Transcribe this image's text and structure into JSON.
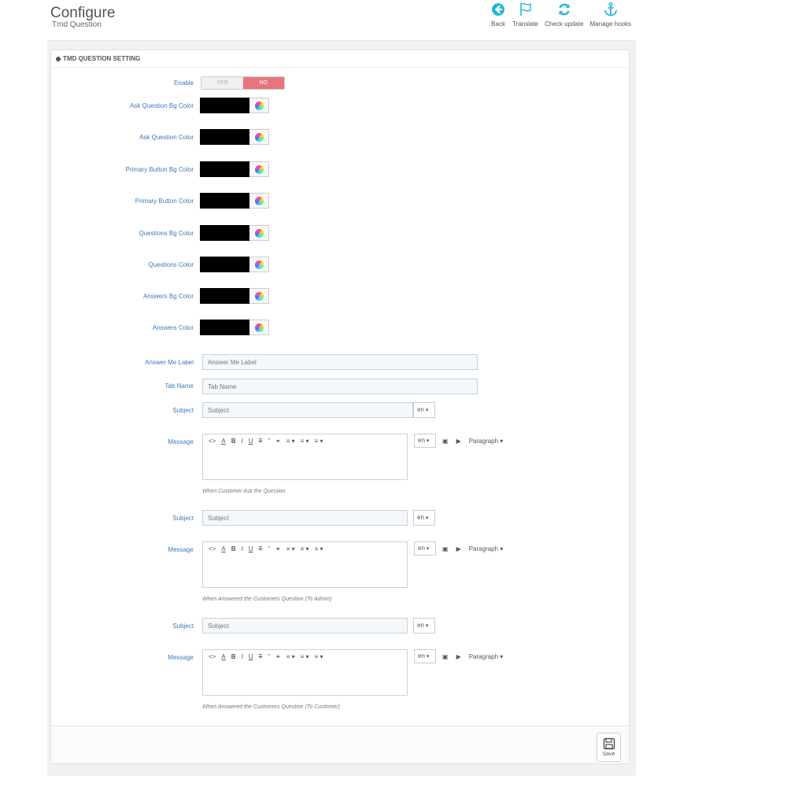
{
  "header": {
    "title": "Configure",
    "subtitle": "Tmd Question",
    "toolbar": [
      {
        "label": "Back",
        "icon": "back-arrow-icon"
      },
      {
        "label": "Translate",
        "icon": "flag-icon"
      },
      {
        "label": "Check update",
        "icon": "refresh-icon"
      },
      {
        "label": "Manage hooks",
        "icon": "anchor-icon"
      }
    ]
  },
  "panel": {
    "title": "TMD QUESTION SETTING",
    "enable": {
      "label": "Enable",
      "yes": "YES",
      "no": "NO",
      "selected": "NO"
    },
    "colors": [
      {
        "label": "Ask Question Bg Color",
        "value": "#000000"
      },
      {
        "label": "Ask Question Color",
        "value": "#000000"
      },
      {
        "label": "Primary Button Bg Color",
        "value": "#000000"
      },
      {
        "label": "Primary Button Color",
        "value": "#000000"
      },
      {
        "label": "Questions Bg Color",
        "value": "#000000"
      },
      {
        "label": "Questions Color",
        "value": "#000000"
      },
      {
        "label": "Answers Bg Color",
        "value": "#000000"
      },
      {
        "label": "Answers Color",
        "value": "#000000"
      }
    ],
    "answer_me_label": {
      "label": "Answer Me Label",
      "placeholder": "Answer Me Label"
    },
    "tab_name": {
      "label": "Tab Name",
      "placeholder": "Tab Name"
    },
    "emails": [
      {
        "subject_label": "Subject",
        "subject_placeholder": "Subject",
        "lang": "en",
        "message_label": "Message",
        "help": "When Customer Ask the Question"
      },
      {
        "subject_label": "Subject",
        "subject_placeholder": "Subject",
        "lang": "en",
        "message_label": "Message",
        "help": "When Answered the Customers Question (To Admin)"
      },
      {
        "subject_label": "Subject",
        "subject_placeholder": "Subject",
        "lang": "en",
        "message_label": "Message",
        "help": "When Answered the Customers Question (To Customer)"
      }
    ],
    "editor": {
      "paragraph": "Paragraph",
      "lang": "en"
    },
    "save_label": "Save"
  },
  "colors": {
    "accent": "#25b9d7",
    "switch_on": "#e8757c",
    "label": "#3b7bb5"
  }
}
